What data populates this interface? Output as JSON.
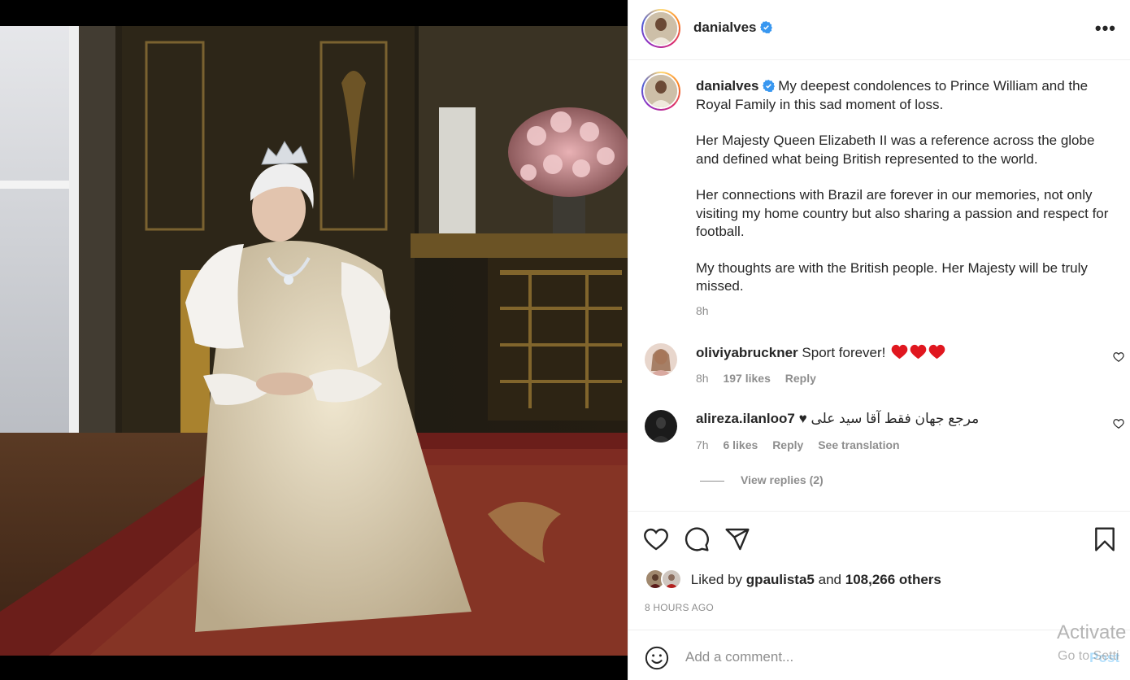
{
  "post": {
    "username": "danialves",
    "verified": true,
    "more_icon": "more-horizontal-icon",
    "caption_paragraphs": [
      "My deepest condolences to Prince William and the Royal Family in this sad moment of loss.",
      "Her Majesty Queen Elizabeth II was a reference across the globe and defined what being British represented to the world.",
      "Her connections with Brazil are forever in our memories, not only visiting my home country but also sharing a passion and respect for football.",
      "My thoughts are with the British people. Her Majesty will be truly missed."
    ],
    "caption_time": "8h"
  },
  "comments": [
    {
      "username": "oliviyabruckner",
      "text": "Sport forever!",
      "emoji": "❤️❤️❤️",
      "time": "8h",
      "likes": "197 likes",
      "reply": "Reply",
      "see_translation": ""
    },
    {
      "username": "alireza.ilanloo7",
      "text": "مرجع جهان فقط آقا سید علی ♥",
      "time": "7h",
      "likes": "6 likes",
      "reply": "Reply",
      "see_translation": "See translation"
    }
  ],
  "view_replies": "View replies (2)",
  "actions": {
    "like_icon": "heart-icon",
    "comment_icon": "comment-icon",
    "share_icon": "share-icon",
    "save_icon": "bookmark-icon"
  },
  "likes": {
    "prefix": "Liked by",
    "user": "gpaulista5",
    "conj": "and",
    "others": "108,266 others"
  },
  "posted_ago": "8 HOURS AGO",
  "add_comment": {
    "placeholder": "Add a comment...",
    "post_label": "Post"
  },
  "watermark": {
    "line1": "Activate",
    "line2": "Go to Setti"
  },
  "colors": {
    "verified_blue": "#3897f0",
    "heart_red": "#ed4956",
    "muted_text": "#8e8e8e"
  }
}
